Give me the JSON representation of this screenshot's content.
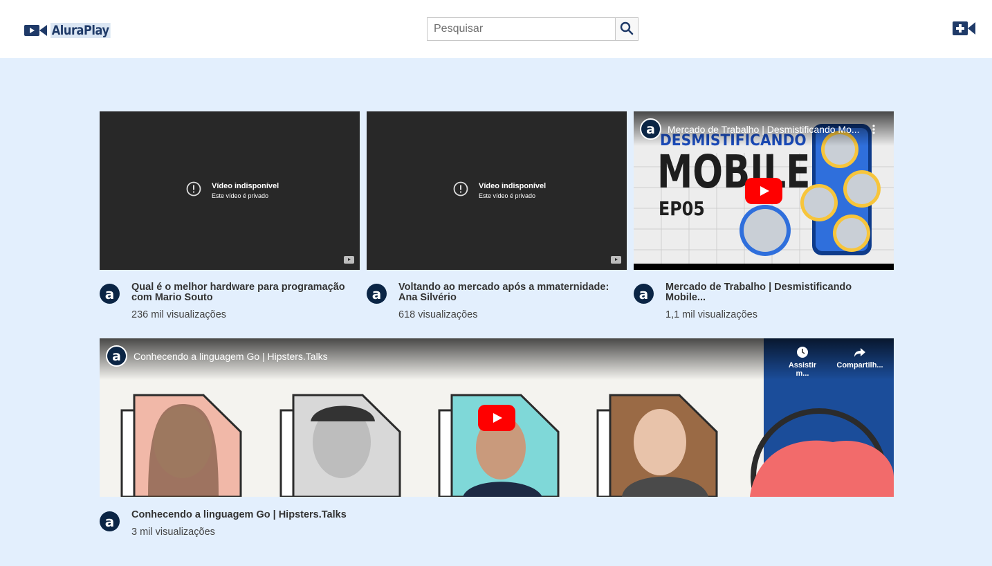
{
  "header": {
    "logo_text": "AluraPlay",
    "search": {
      "placeholder": "Pesquisar",
      "value": ""
    }
  },
  "icons": {
    "logo": "video-camera-icon",
    "search": "magnifier-icon",
    "add_video": "add-video-icon",
    "channel": "alura-a-icon"
  },
  "colors": {
    "header_bg": "#ffffff",
    "page_bg": "#e3effd",
    "brand": "#1f3a68",
    "yt_red": "#ff0000"
  },
  "videos": [
    {
      "title": "Qual é o melhor hardware para programação com Mario Souto",
      "views": "236 mil visualizações",
      "player": {
        "status_title": "Vídeo indisponível",
        "status_sub": "Este vídeo é privado"
      }
    },
    {
      "title": "Voltando ao mercado após a mmaternidade: Ana Silvério",
      "views": "618 visualizações",
      "player": {
        "status_title": "Vídeo indisponível",
        "status_sub": "Este vídeo é privado"
      }
    },
    {
      "title": "Mercado de Trabalho | Desmistificando Mobile...",
      "views": "1,1 mil visualizações",
      "player": {
        "overlay_title": "Mercado de Trabalho | Desmistificando Mo...",
        "thumb_line1": "DESMISTIFICANDO",
        "thumb_line2": "MOBILE",
        "thumb_line3": "EP05"
      }
    },
    {
      "title": "Conhecendo a linguagem Go | Hipsters.Talks",
      "views": "3 mil visualizações",
      "player": {
        "overlay_title": "Conhecendo a linguagem Go | Hipsters.Talks",
        "watch_later": "Assistir m...",
        "share": "Compartilh..."
      }
    }
  ]
}
